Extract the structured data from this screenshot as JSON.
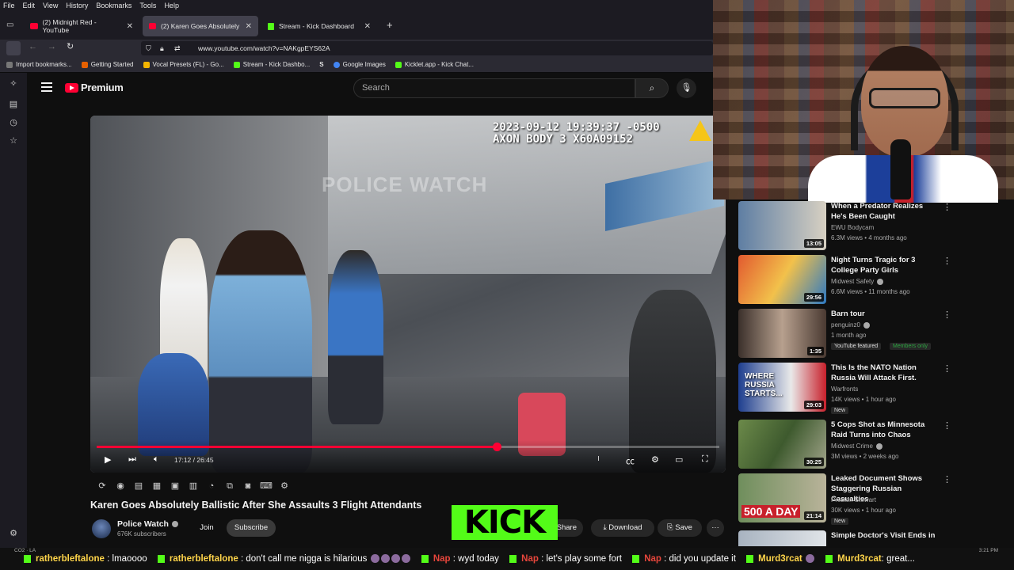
{
  "browser": {
    "menu": [
      "File",
      "Edit",
      "View",
      "History",
      "Bookmarks",
      "Tools",
      "Help"
    ],
    "tabs": [
      {
        "label": "(2) Midnight Red - YouTube",
        "active": false
      },
      {
        "label": "(2) Karen Goes Absolutely Ballis",
        "active": true
      },
      {
        "label": "Stream - Kick Dashboard",
        "active": false
      }
    ],
    "new_tab": "+",
    "url": "www.youtube.com/watch?v=NAKgpEYS62A",
    "bookmarks": [
      "Import bookmarks...",
      "Getting Started",
      "Vocal Presets (FL) - Go...",
      "Stream - Kick Dashbo...",
      "S",
      "Google Images",
      "Kicklet.app - Kick Chat..."
    ]
  },
  "youtube": {
    "logo_text": "Premium",
    "search_placeholder": "Search"
  },
  "player": {
    "osd_line1": "2023-09-12 19:39:37 -0500",
    "osd_line2": "AXON BODY 3 X60A09152",
    "watermark": "POLICE WATCH",
    "time": "17:12 / 26:45",
    "progress_fraction": 0.643
  },
  "video": {
    "title": "Karen Goes Absolutely Ballistic After She Assaults 3 Flight Attendants",
    "channel": "Police Watch",
    "subscribers": "676K subscribers",
    "join_label": "Join",
    "subscribe_label": "Subscribe",
    "share_label": "Share",
    "download_label": "Download",
    "save_label": "Save",
    "more_label": "···"
  },
  "overlay": {
    "kick_logo": "KICK"
  },
  "recommendations": [
    {
      "title": "When a Predator Realizes He's Been Caught",
      "channel": "EWU Bodycam",
      "meta": "6.3M views • 4 months ago",
      "duration": "13:05",
      "badges": []
    },
    {
      "title": "Night Turns Tragic for 3 College Party Girls",
      "channel": "Midwest Safety",
      "meta": "6.6M views • 11 months ago",
      "duration": "29:56",
      "badges": []
    },
    {
      "title": "Barn tour",
      "channel": "penguinz0",
      "meta": "1 month ago",
      "duration": "1:35",
      "badges": [
        "YouTube featured",
        "Members only"
      ]
    },
    {
      "title": "This Is the NATO Nation Russia Will Attack First.",
      "channel": "Warfronts",
      "meta": "14K views • 1 hour ago",
      "duration": "29:03",
      "badges": [
        "New"
      ],
      "thumb_text": "WHERE RUSSIA STARTS..."
    },
    {
      "title": "5 Cops Shot as Minnesota Raid Turns into Chaos",
      "channel": "Midwest Crime",
      "meta": "3M views • 2 weeks ago",
      "duration": "30:25",
      "badges": []
    },
    {
      "title": "Leaked Document Shows Staggering Russian Casualties",
      "channel": "Preston Stewart",
      "meta": "30K views • 1 hour ago",
      "duration": "21:14",
      "badges": [
        "New"
      ],
      "thumb_text": "500 A DAY"
    },
    {
      "title": "Simple Doctor's Visit Ends in",
      "channel": "",
      "meta": "",
      "duration": "",
      "badges": []
    }
  ],
  "chat": [
    {
      "user": "ratherbleftalone",
      "message": ": lmaoooo"
    },
    {
      "user": "ratherbleftalone",
      "message": ": don't call me nigga is hilarious"
    },
    {
      "user": "Nap",
      "message": ": wyd today"
    },
    {
      "user": "Nap",
      "message": ": let's play some fort"
    },
    {
      "user": "Nap",
      "message": ": did you update it"
    },
    {
      "user": "Murd3rcat",
      "message": ""
    },
    {
      "user": "Murd3rcat",
      "message": ": great..."
    }
  ],
  "system": {
    "weather": "CO2 · LA",
    "clock": "3:21 PM"
  },
  "colors": {
    "youtube_red": "#ff0033",
    "kick_green": "#53fc18",
    "chat_user": "#ffd54a"
  }
}
